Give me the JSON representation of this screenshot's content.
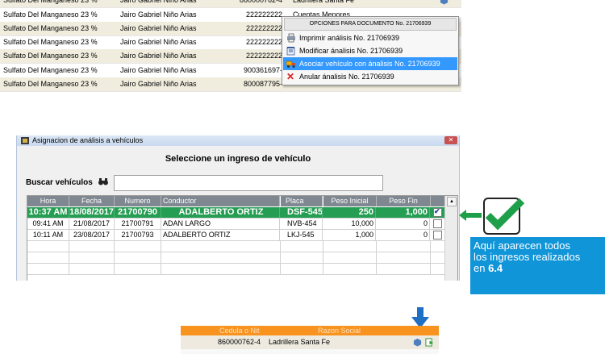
{
  "top_grid": {
    "rows": [
      {
        "product": "Sulfato Del Manganeso 23 %",
        "person": "Jairo Gabriel Niño Arias",
        "doc": "860000762-4",
        "company": "Ladrillera Santa Fe"
      },
      {
        "product": "Sulfato Del Manganeso 23 %",
        "person": "Jairo Gabriel Niño Arias",
        "doc": "222222222",
        "company": "Cuentas Menores"
      },
      {
        "product": "Sulfato Del Manganeso 23 %",
        "person": "Jairo Gabriel Niño Arias",
        "doc": "222222222",
        "company": ""
      },
      {
        "product": "Sulfato Del Manganeso 23 %",
        "person": "Jairo Gabriel Niño Arias",
        "doc": "222222222",
        "company": ""
      },
      {
        "product": "Sulfato Del Manganeso 23 %",
        "person": "Jairo Gabriel Niño Arias",
        "doc": "222222222",
        "company": ""
      },
      {
        "product": "Sulfato Del Manganeso 23 %",
        "person": "Jairo Gabriel Niño Arias",
        "doc": "900361697-",
        "company": ""
      },
      {
        "product": "Sulfato Del Manganeso 23 %",
        "person": "Jairo Gabriel Niño Arias",
        "doc": "800087795-",
        "company": ""
      }
    ]
  },
  "context_menu": {
    "header": "OPCIONES PARA DOCUMENTO No. 21706939",
    "items": [
      {
        "label": "Imprimir análisis No. 21706939",
        "icon": "printer-icon"
      },
      {
        "label": "Modificar ánalisis No. 21706939",
        "icon": "edit-form-icon"
      },
      {
        "label": "Asociar vehículo con ánalisis No. 21706939",
        "icon": "truck-icon"
      },
      {
        "label": "Anular ánalisis No. 21706939",
        "icon": "red-x-icon"
      }
    ]
  },
  "dialog": {
    "title": "Asignacion de análisis a vehículos",
    "close": "✕",
    "subtitle": "Seleccione un ingreso de vehículo",
    "search_label": "Buscar vehículos",
    "search_value": "",
    "columns": [
      "Hora",
      "Fecha",
      "Numero",
      "Conductor",
      "Placa",
      "Peso Inicial",
      "Peso Fin"
    ],
    "rows": [
      {
        "hora": "10:37 AM",
        "fecha": "18/08/2017",
        "numero": "21700790",
        "conductor": "ADALBERTO ORTIZ",
        "placa": "DSF-545",
        "peso_inicial": "250",
        "peso_fin": "1,000",
        "checked": true
      },
      {
        "hora": "09:41 AM",
        "fecha": "21/08/2017",
        "numero": "21700791",
        "conductor": "ADAN LARGO",
        "placa": "NVB-454",
        "peso_inicial": "10,000",
        "peso_fin": "0",
        "checked": false
      },
      {
        "hora": "10:11 AM",
        "fecha": "23/08/2017",
        "numero": "21700793",
        "conductor": "ADALBERTO ORTIZ",
        "placa": "LKJ-545",
        "peso_inicial": "1,000",
        "peso_fin": "0",
        "checked": false
      }
    ]
  },
  "callout": {
    "line1": "Aquí aparecen todos",
    "line2": "los ingresos realizados",
    "line3": "en",
    "bold": "6.4"
  },
  "bottom_fragment": {
    "header_left": "Cedula o Nit",
    "header_right": "Razon Social",
    "doc": "860000762-4",
    "company": "Ladrillera Santa Fe"
  },
  "colors": {
    "selected_row": "#259e53",
    "menu_highlight": "#3399ff",
    "callout_blue": "#0f95d8",
    "orange_header": "#f7931e"
  }
}
